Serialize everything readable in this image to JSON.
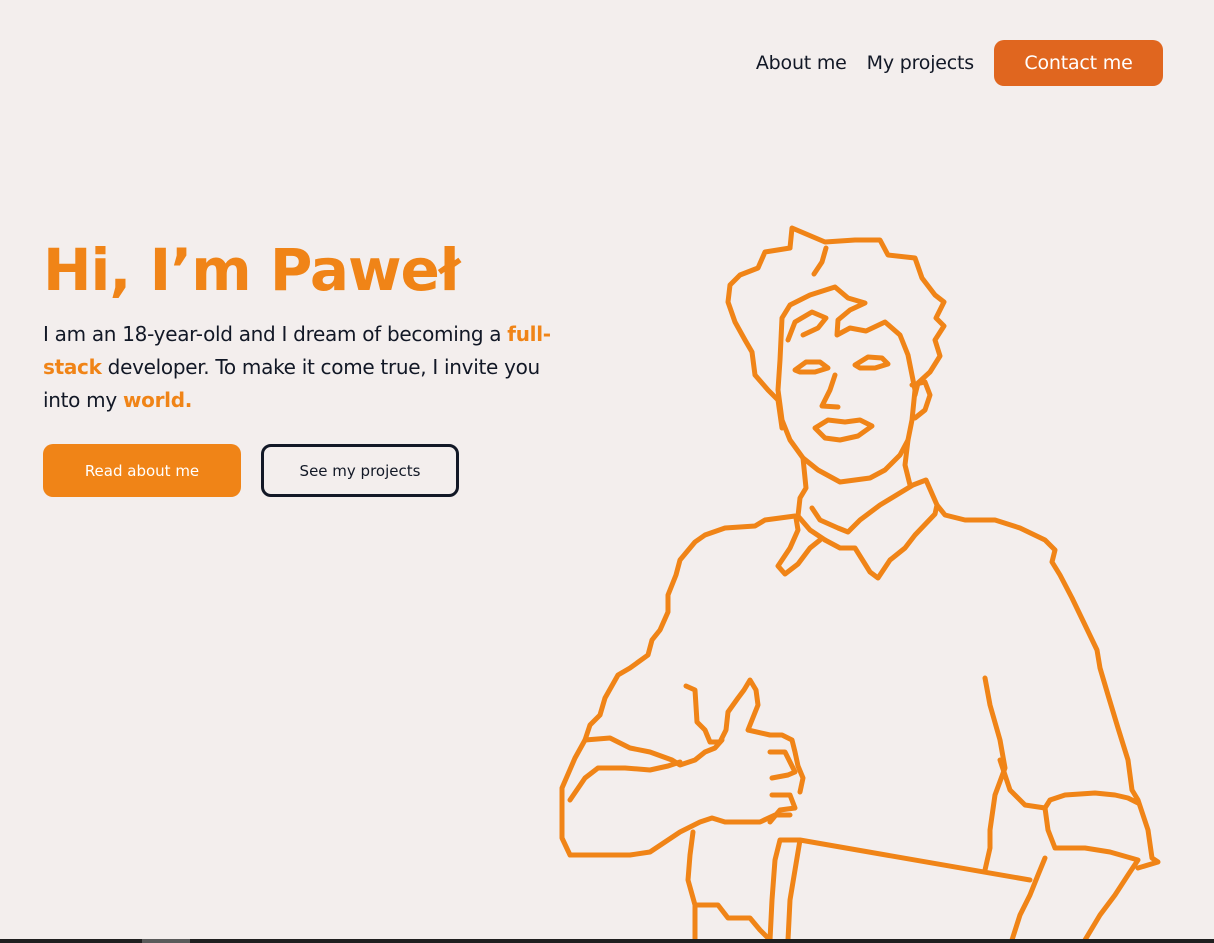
{
  "nav": {
    "about": "About me",
    "projects": "My projects",
    "contact": "Contact me"
  },
  "hero": {
    "title": "Hi, I’m Paweł",
    "text_1": "I am an 18-year-old and I dream of becoming a ",
    "highlight_1": "full-stack",
    "text_2": " developer. To make it come true, I invite you into my ",
    "highlight_2": "world.",
    "primary_button": "Read about me",
    "secondary_button": "See my projects"
  },
  "colors": {
    "background": "#f3eeed",
    "accent": "#f08417",
    "contact_button": "#e0661f",
    "text": "#121826"
  },
  "illustration": {
    "icon": "person-thumbs-up-line-art"
  }
}
